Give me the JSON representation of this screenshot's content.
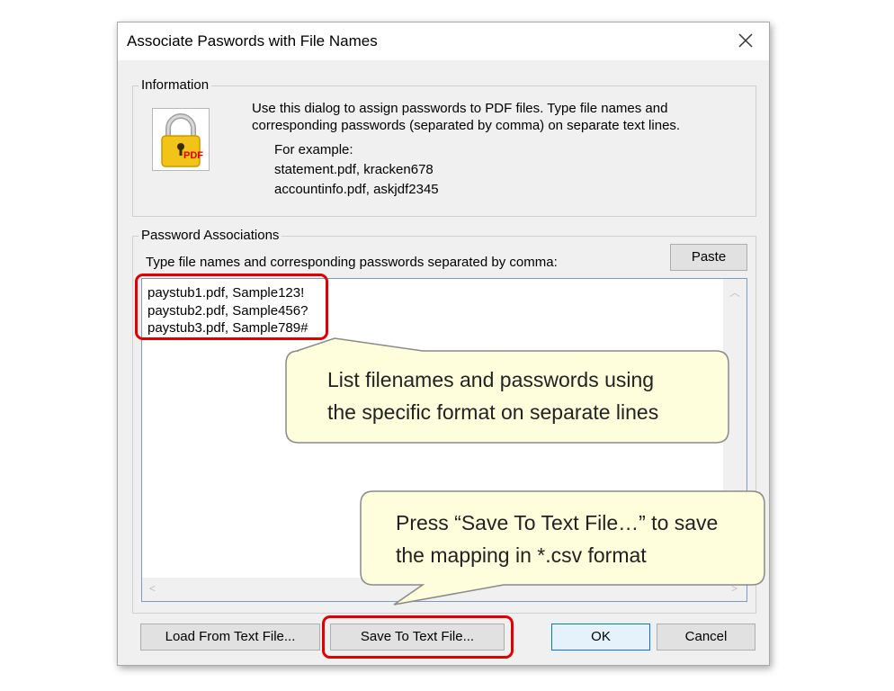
{
  "dialog": {
    "title": "Associate Paswords with File Names"
  },
  "information": {
    "label": "Information",
    "line1": "Use this dialog to assign passwords to PDF files. Type file names and",
    "line2": "corresponding passwords (separated by comma) on separate text lines.",
    "example_heading": "For example:",
    "example_line1": "statement.pdf, kracken678",
    "example_line2": "accountinfo.pdf, askjdf2345",
    "icon_badge": "PDF"
  },
  "associations": {
    "label": "Password Associations",
    "instruction": "Type file names and corresponding passwords separated by comma:",
    "paste_label": "Paste",
    "text_value": "paystub1.pdf, Sample123!\npaystub2.pdf, Sample456?\npaystub3.pdf, Sample789#"
  },
  "buttons": {
    "load": "Load From Text File...",
    "save": "Save To Text File...",
    "ok": "OK",
    "cancel": "Cancel"
  },
  "callouts": {
    "list_line1": "List filenames and passwords using",
    "list_line2": "the specific format on separate lines",
    "save_line1": "Press “Save To Text File…” to save",
    "save_line2": "the mapping in *.csv format"
  },
  "colors": {
    "callout_fill": "#fefedc",
    "highlight": "#e00000",
    "default_button_border": "#0078d7"
  }
}
